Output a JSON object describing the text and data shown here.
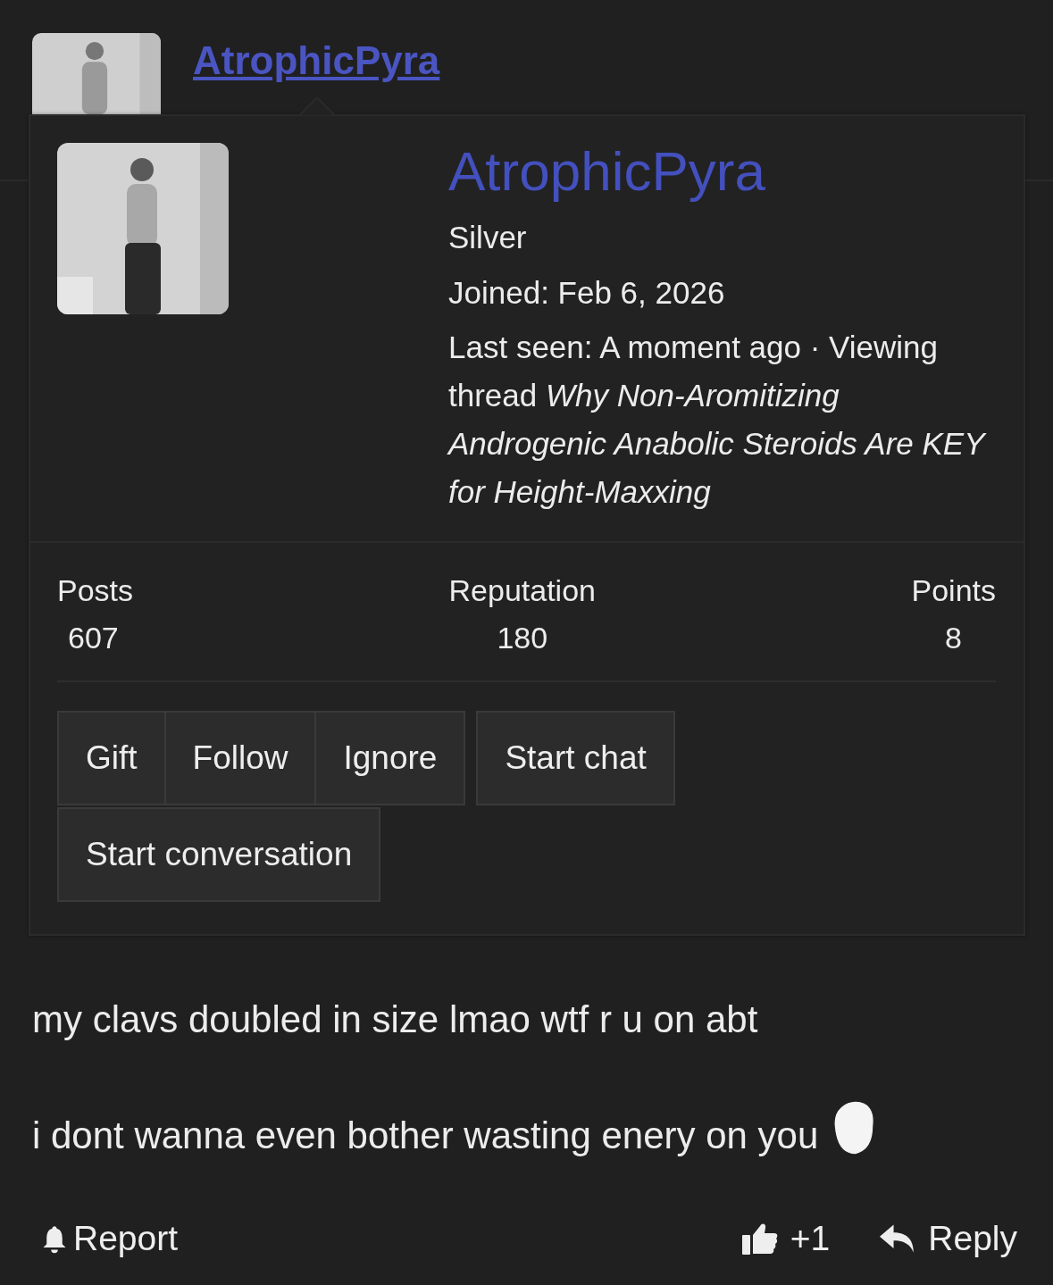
{
  "header": {
    "username": "AtrophicPyra"
  },
  "popup": {
    "username": "AtrophicPyra",
    "rank": "Silver",
    "joined": "Joined: Feb 6, 2026",
    "last_seen": "Last seen: A moment ago · Viewing thread *Why Non-Aromitizing Androgenic Anabolic Steroids Are KEY for Height-Maxxing*",
    "stats": [
      {
        "label": "Posts",
        "value": "607"
      },
      {
        "label": "Reputation",
        "value": "180"
      },
      {
        "label": "Points",
        "value": "8"
      }
    ],
    "buttons": [
      [
        "Gift",
        "Follow",
        "Ignore"
      ],
      [
        "Start chat"
      ],
      [
        "Start conversation"
      ]
    ]
  },
  "post": {
    "paragraphs": [
      "my clavs doubled in size lmao wtf r u on abt",
      "i dont wanna even bother wasting enery on you"
    ]
  },
  "footer": {
    "report": "Report",
    "likes": "+1",
    "reply": "Reply"
  }
}
